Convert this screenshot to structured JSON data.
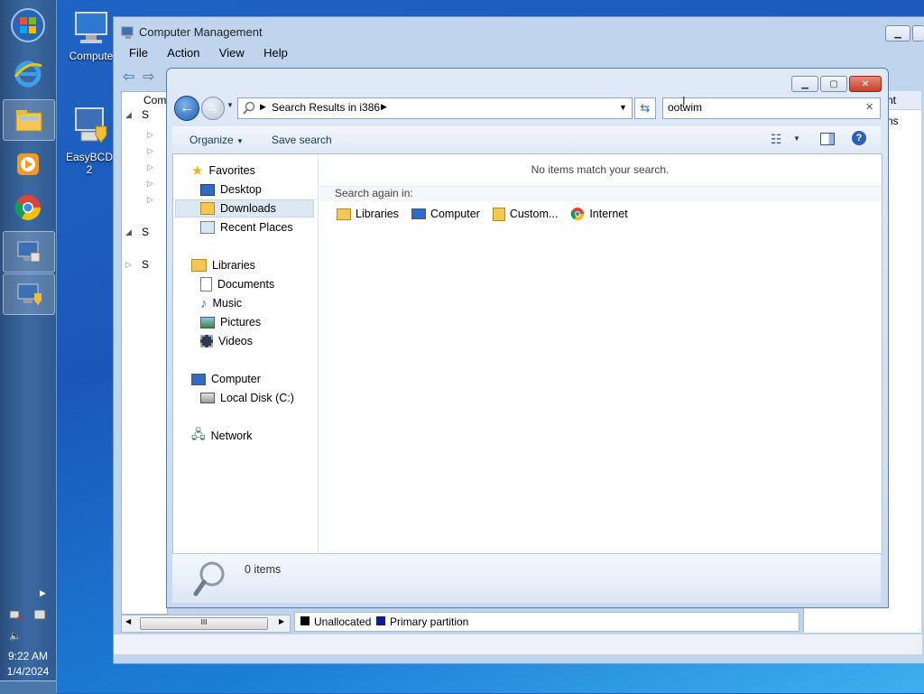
{
  "taskbar": {
    "time": "9:22 AM",
    "date": "1/4/2024"
  },
  "desktop": {
    "icon1_label": "Compute",
    "icon2_label": "EasyBCD 2"
  },
  "cm": {
    "title": "Computer Management",
    "menu": [
      "File",
      "Action",
      "View",
      "Help"
    ],
    "tree_root": "Comp",
    "right_header": "nt",
    "right_text": "ns",
    "legend_unallocated": "Unallocated",
    "legend_primary": "Primary partition"
  },
  "explorer": {
    "address": "Search Results in i386",
    "search_value": "ootwim",
    "toolbar": {
      "organize": "Organize",
      "save_search": "Save search"
    },
    "nav": {
      "favorites": "Favorites",
      "desktop": "Desktop",
      "downloads": "Downloads",
      "recent": "Recent Places",
      "libraries": "Libraries",
      "documents": "Documents",
      "music": "Music",
      "pictures": "Pictures",
      "videos": "Videos",
      "computer": "Computer",
      "local_disk": "Local Disk (C:)",
      "network": "Network"
    },
    "content": {
      "no_items": "No items match your search.",
      "search_again": "Search again in:",
      "options": [
        "Libraries",
        "Computer",
        "Custom...",
        "Internet"
      ]
    },
    "status_count": "0 items"
  },
  "colors": {
    "accent": "#1e5fb4",
    "taskbar": "#2f5a8f"
  }
}
